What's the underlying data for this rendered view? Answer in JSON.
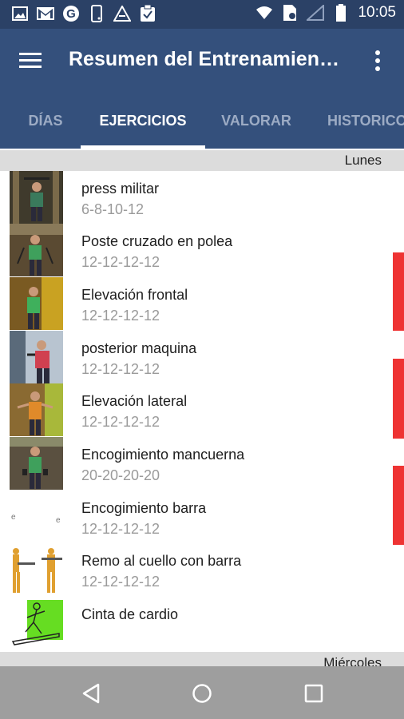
{
  "status_bar": {
    "time": "10:05",
    "left_icons": [
      "image-icon",
      "gmail-icon",
      "google-icon",
      "phone-icon",
      "app-icon",
      "clipboard-icon"
    ],
    "right_icons": [
      "wifi-icon",
      "sim-icon",
      "signal-icon",
      "battery-icon"
    ]
  },
  "app_bar": {
    "title": "Resumen del Entrenamien…",
    "menu_icon": "hamburger-icon",
    "more_icon": "more-vert-icon"
  },
  "tabs": [
    {
      "label": "DÍAS",
      "active": false
    },
    {
      "label": "EJERCICIOS",
      "active": true
    },
    {
      "label": "VALORAR",
      "active": false
    },
    {
      "label": "HISTORICO",
      "active": false
    }
  ],
  "sections": [
    {
      "day": "Lunes",
      "exercises": [
        {
          "name": "press militar",
          "reps": "6-8-10-12"
        },
        {
          "name": "Poste cruzado en polea",
          "reps": "12-12-12-12"
        },
        {
          "name": "Elevación frontal",
          "reps": "12-12-12-12"
        },
        {
          "name": "posterior maquina",
          "reps": "12-12-12-12"
        },
        {
          "name": "Elevación lateral",
          "reps": "12-12-12-12"
        },
        {
          "name": "Encogimiento mancuerna",
          "reps": "20-20-20-20"
        },
        {
          "name": "Encogimiento barra",
          "reps": "12-12-12-12"
        },
        {
          "name": "Remo al cuello con barra",
          "reps": "12-12-12-12"
        },
        {
          "name": "Cinta de cardio",
          "reps": ""
        }
      ]
    },
    {
      "day": "Miércoles",
      "exercises": []
    }
  ],
  "colors": {
    "status_bar": "#2b4166",
    "app_bar": "#34507c",
    "accent_marker": "#ee3333",
    "nav_bar": "#9e9e9e"
  },
  "nav_bar": {
    "back_icon": "back-triangle-icon",
    "home_icon": "home-circle-icon",
    "recents_icon": "recents-square-icon"
  }
}
